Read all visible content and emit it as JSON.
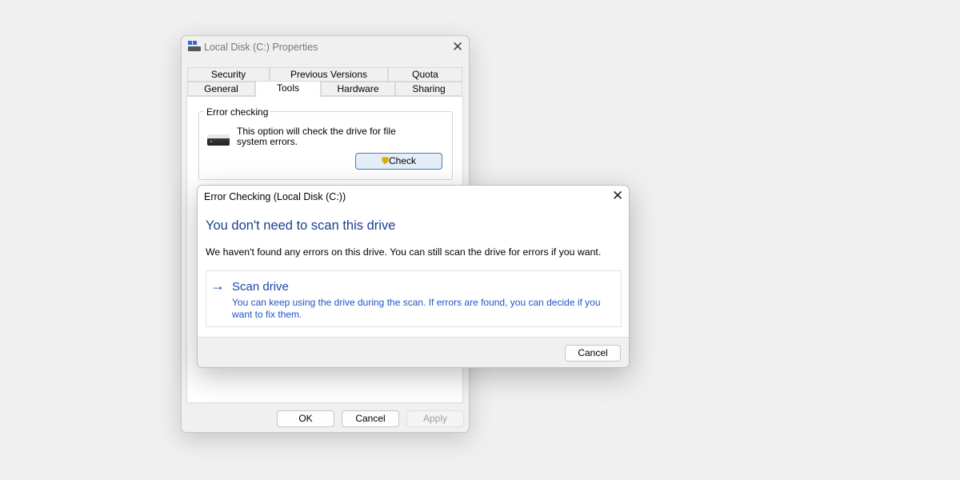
{
  "properties_window": {
    "title": "Local Disk (C:) Properties",
    "tabs_row1": [
      "Security",
      "Previous Versions",
      "Quota"
    ],
    "tabs_row2": [
      "General",
      "Tools",
      "Hardware",
      "Sharing"
    ],
    "active_tab": "Tools",
    "error_checking": {
      "heading": "Error checking",
      "description": "This option will check the drive for file system errors.",
      "check_label": "Check"
    },
    "buttons": {
      "ok": "OK",
      "cancel": "Cancel",
      "apply": "Apply"
    }
  },
  "error_dialog": {
    "title": "Error Checking (Local Disk (C:))",
    "heading": "You don't need to scan this drive",
    "body": "We haven't found any errors on this drive. You can still scan the drive for errors if you want.",
    "option": {
      "label": "Scan drive",
      "description": "You can keep using the drive during the scan. If errors are found, you can decide if you want to fix them."
    },
    "cancel_label": "Cancel"
  },
  "colors": {
    "accent": "#1a46a8",
    "link": "#2254c4"
  }
}
